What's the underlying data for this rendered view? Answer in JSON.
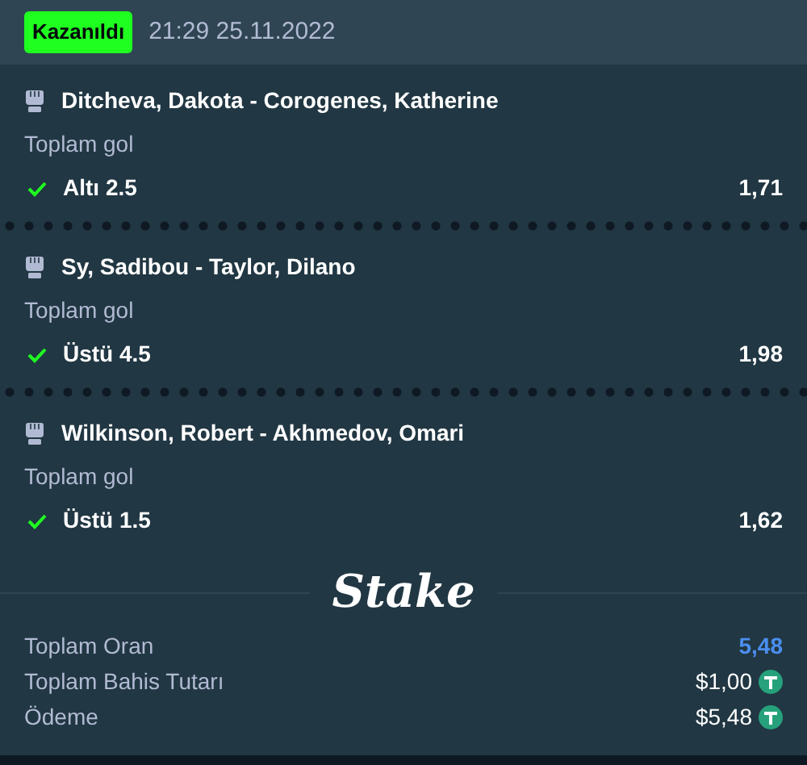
{
  "header": {
    "status": {
      "label": "Kazanıldı",
      "kind": "won"
    },
    "datetime": "21:29 25.11.2022"
  },
  "bets": [
    {
      "match": "Ditcheva, Dakota - Corogenes, Katherine",
      "market": "Toplam gol",
      "selection": "Altı 2.5",
      "odds": "1,71",
      "won": true
    },
    {
      "match": "Sy, Sadibou - Taylor, Dilano",
      "market": "Toplam gol",
      "selection": "Üstü 4.5",
      "odds": "1,98",
      "won": true
    },
    {
      "match": "Wilkinson, Robert - Akhmedov, Omari",
      "market": "Toplam gol",
      "selection": "Üstü 1.5",
      "odds": "1,62",
      "won": true
    }
  ],
  "logo": "Stake",
  "summary": [
    {
      "label": "Toplam Oran",
      "value": "5,48",
      "kind": "odds"
    },
    {
      "label": "Toplam Bahis Tutarı",
      "value": "$1,00",
      "kind": "currency"
    },
    {
      "label": "Ödeme",
      "value": "$5,48",
      "kind": "currency"
    }
  ]
}
